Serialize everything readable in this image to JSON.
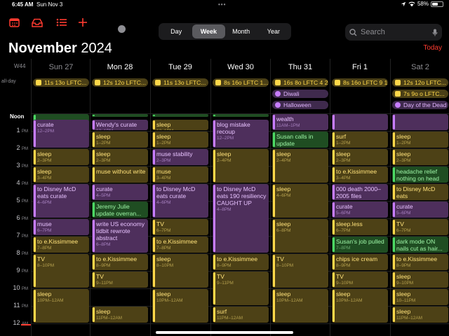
{
  "status": {
    "time": "6:45 AM",
    "date": "Sun Nov 3",
    "battery": "58%",
    "battery_level": 0.58
  },
  "toolbar": {
    "views": [
      "Day",
      "Week",
      "Month",
      "Year"
    ],
    "active_view": "Week",
    "search_placeholder": "Search"
  },
  "header": {
    "month": "November",
    "year": "2024",
    "today_label": "Today",
    "week_label": "W44"
  },
  "days": [
    {
      "label": "Sun 27",
      "weekend": true
    },
    {
      "label": "Mon 28",
      "weekend": false
    },
    {
      "label": "Tue 29",
      "weekend": false
    },
    {
      "label": "Wed 30",
      "weekend": false
    },
    {
      "label": "Thu 31",
      "weekend": false
    },
    {
      "label": "Fri 1",
      "weekend": false
    },
    {
      "label": "Sat 2",
      "weekend": true
    }
  ],
  "allday_label": "all-day",
  "allday_events": [
    {
      "day": 0,
      "row": 0,
      "title": "11s 13o LFTC...",
      "color": "yellow"
    },
    {
      "day": 1,
      "row": 0,
      "title": "12s 12o LFTC...",
      "color": "yellow"
    },
    {
      "day": 2,
      "row": 0,
      "title": "11s 13o LFTC...",
      "color": "yellow"
    },
    {
      "day": 3,
      "row": 0,
      "title": "8s 16o LFTC 1...",
      "color": "yellow"
    },
    {
      "day": 4,
      "row": 0,
      "title": "16s 8o LFTC 4 2",
      "color": "yellow"
    },
    {
      "day": 4,
      "row": 1,
      "title": "Diwali",
      "color": "purple"
    },
    {
      "day": 4,
      "row": 2,
      "title": "Halloween",
      "color": "purple"
    },
    {
      "day": 5,
      "row": 0,
      "title": "8s 16o LFTC 9 1",
      "color": "yellow"
    },
    {
      "day": 6,
      "row": 0,
      "title": "12s 12o LFTC...",
      "color": "yellow"
    },
    {
      "day": 6,
      "row": 1,
      "title": "7s 9o o LFTC...",
      "color": "yellow"
    },
    {
      "day": 6,
      "row": 2,
      "title": "Day of the Dead",
      "color": "purple"
    }
  ],
  "noon_label": "Noon",
  "hours": [
    {
      "n": "1",
      "ap": "PM"
    },
    {
      "n": "2",
      "ap": "PM"
    },
    {
      "n": "3",
      "ap": "PM"
    },
    {
      "n": "4",
      "ap": "PM"
    },
    {
      "n": "5",
      "ap": "PM"
    },
    {
      "n": "6",
      "ap": "PM"
    },
    {
      "n": "7",
      "ap": "PM"
    },
    {
      "n": "8",
      "ap": "PM"
    },
    {
      "n": "9",
      "ap": "PM"
    },
    {
      "n": "10",
      "ap": "PM"
    },
    {
      "n": "11",
      "ap": "PM"
    },
    {
      "n": "12",
      "ap": "AM"
    }
  ],
  "events": [
    {
      "day": 0,
      "start": 12.0,
      "end": 13.0,
      "title": "",
      "time": "",
      "color": "g"
    },
    {
      "day": 0,
      "start": 12.3,
      "end": 14.0,
      "title": "curate",
      "time": "12–2PM",
      "color": "p"
    },
    {
      "day": 0,
      "start": 14.0,
      "end": 15.0,
      "title": "sleep",
      "time": "2–3PM",
      "color": "y"
    },
    {
      "day": 0,
      "start": 15.0,
      "end": 16.0,
      "title": "sleep",
      "time": "3–4PM",
      "color": "y"
    },
    {
      "day": 0,
      "start": 16.0,
      "end": 18.0,
      "title": "to Disney McD eats curate",
      "time": "4–6PM",
      "color": "p"
    },
    {
      "day": 0,
      "start": 18.0,
      "end": 19.0,
      "title": "muse",
      "time": "6–7PM",
      "color": "p"
    },
    {
      "day": 0,
      "start": 19.0,
      "end": 20.0,
      "title": "to e.Kissimmee",
      "time": "7–8PM",
      "color": "y"
    },
    {
      "day": 0,
      "start": 20.0,
      "end": 22.0,
      "title": "TV",
      "time": "8–10PM",
      "color": "y"
    },
    {
      "day": 0,
      "start": 22.0,
      "end": 24.0,
      "title": "sleep",
      "time": "10PM–12AM",
      "color": "y"
    },
    {
      "day": 1,
      "start": 12.0,
      "end": 12.25,
      "title": "",
      "time": "",
      "color": "g"
    },
    {
      "day": 1,
      "start": 12.3,
      "end": 13.0,
      "title": "Wendy's curate",
      "time": "12–1PM",
      "color": "p"
    },
    {
      "day": 1,
      "start": 13.0,
      "end": 14.0,
      "title": "sleep",
      "time": "1–2PM",
      "color": "y"
    },
    {
      "day": 1,
      "start": 14.0,
      "end": 15.0,
      "title": "sleep",
      "time": "2–3PM",
      "color": "y"
    },
    {
      "day": 1,
      "start": 15.0,
      "end": 16.0,
      "title": "muse without write",
      "time": "",
      "color": "y"
    },
    {
      "day": 1,
      "start": 16.0,
      "end": 17.0,
      "title": "curate",
      "time": "4–5PM",
      "color": "p"
    },
    {
      "day": 1,
      "start": 17.0,
      "end": 18.0,
      "title": "Jeremy Julie update overran...",
      "time": "",
      "color": "g"
    },
    {
      "day": 1,
      "start": 18.0,
      "end": 20.0,
      "title": "write US economy tidbit rewrote abstract",
      "time": "6–8PM",
      "color": "p"
    },
    {
      "day": 1,
      "start": 20.0,
      "end": 21.0,
      "title": "to e.Kissimmee",
      "time": "8–9PM",
      "color": "y"
    },
    {
      "day": 1,
      "start": 21.0,
      "end": 22.0,
      "title": "TV",
      "time": "9–11PM",
      "color": "y"
    },
    {
      "day": 1,
      "start": 23.0,
      "end": 24.0,
      "title": "sleep",
      "time": "11PM–12AM",
      "color": "y"
    },
    {
      "day": 2,
      "start": 12.0,
      "end": 12.25,
      "title": "",
      "time": "",
      "color": "g"
    },
    {
      "day": 2,
      "start": 12.3,
      "end": 13.0,
      "title": "sleep",
      "time": "12–1PM",
      "color": "y"
    },
    {
      "day": 2,
      "start": 13.0,
      "end": 14.0,
      "title": "sleep",
      "time": "1–2PM",
      "color": "y"
    },
    {
      "day": 2,
      "start": 14.0,
      "end": 15.0,
      "title": "muse stability",
      "time": "2–3PM",
      "color": "p"
    },
    {
      "day": 2,
      "start": 15.0,
      "end": 16.0,
      "title": "muse",
      "time": "3–4PM",
      "color": "y"
    },
    {
      "day": 2,
      "start": 16.0,
      "end": 18.0,
      "title": "to Disney McD eats curate",
      "time": "4–6PM",
      "color": "p"
    },
    {
      "day": 2,
      "start": 18.0,
      "end": 19.0,
      "title": "TV",
      "time": "6–7PM",
      "color": "y"
    },
    {
      "day": 2,
      "start": 19.0,
      "end": 20.0,
      "title": "to e.Kissimmee",
      "time": "7–8PM",
      "color": "y"
    },
    {
      "day": 2,
      "start": 20.0,
      "end": 22.0,
      "title": "sleep",
      "time": "8–10PM",
      "color": "y"
    },
    {
      "day": 2,
      "start": 22.0,
      "end": 24.0,
      "title": "sleep",
      "time": "10PM–12AM",
      "color": "y"
    },
    {
      "day": 3,
      "start": 12.0,
      "end": 12.25,
      "title": "",
      "time": "",
      "color": "g"
    },
    {
      "day": 3,
      "start": 12.3,
      "end": 14.0,
      "title": "blog mistake recoup",
      "time": "12–2PM",
      "color": "p"
    },
    {
      "day": 3,
      "start": 14.0,
      "end": 16.0,
      "title": "sleep",
      "time": "2–4PM",
      "color": "y"
    },
    {
      "day": 3,
      "start": 16.0,
      "end": 20.0,
      "title": "to Disney McD eats 190 resiliency CAUGHT UP",
      "time": "4–8PM",
      "color": "p"
    },
    {
      "day": 3,
      "start": 20.0,
      "end": 21.0,
      "title": "to e.Kissimmee",
      "time": "8–9PM",
      "color": "y"
    },
    {
      "day": 3,
      "start": 21.0,
      "end": 23.0,
      "title": "TV",
      "time": "9–11PM",
      "color": "y"
    },
    {
      "day": 3,
      "start": 23.0,
      "end": 24.0,
      "title": "surf",
      "time": "11PM–12AM",
      "color": "y"
    },
    {
      "day": 4,
      "start": 12.0,
      "end": 13.0,
      "title": "wealth",
      "time": "11AM–1PM",
      "color": "p"
    },
    {
      "day": 4,
      "start": 13.0,
      "end": 14.0,
      "title": "Susan calls in update",
      "time": "",
      "color": "g"
    },
    {
      "day": 4,
      "start": 14.0,
      "end": 16.0,
      "title": "sleep",
      "time": "2–4PM",
      "color": "y"
    },
    {
      "day": 4,
      "start": 16.0,
      "end": 18.0,
      "title": "sleep",
      "time": "4–6PM",
      "color": "y"
    },
    {
      "day": 4,
      "start": 18.0,
      "end": 20.0,
      "title": "sleep",
      "time": "6–8PM",
      "color": "y"
    },
    {
      "day": 4,
      "start": 20.0,
      "end": 22.0,
      "title": "TV",
      "time": "8–10PM",
      "color": "y"
    },
    {
      "day": 4,
      "start": 22.0,
      "end": 24.0,
      "title": "sleep",
      "time": "10PM–12AM",
      "color": "y"
    },
    {
      "day": 5,
      "start": 12.0,
      "end": 13.0,
      "title": "",
      "time": "",
      "color": "p"
    },
    {
      "day": 5,
      "start": 13.0,
      "end": 14.0,
      "title": "surf",
      "time": "1–2PM",
      "color": "y"
    },
    {
      "day": 5,
      "start": 14.0,
      "end": 15.0,
      "title": "sleep",
      "time": "2–3PM",
      "color": "y"
    },
    {
      "day": 5,
      "start": 15.0,
      "end": 16.0,
      "title": "to e.Kissimmee",
      "time": "3–4PM",
      "color": "y"
    },
    {
      "day": 5,
      "start": 16.0,
      "end": 17.0,
      "title": "000 death 2000–2005 files",
      "time": "",
      "color": "p"
    },
    {
      "day": 5,
      "start": 17.0,
      "end": 18.0,
      "title": "curate",
      "time": "5–6PM",
      "color": "p"
    },
    {
      "day": 5,
      "start": 18.0,
      "end": 19.0,
      "title": "sleep.less",
      "time": "6–7PM",
      "color": "y"
    },
    {
      "day": 5,
      "start": 19.0,
      "end": 20.0,
      "title": "Susan's job pulled",
      "time": "7–8PM",
      "color": "g"
    },
    {
      "day": 5,
      "start": 20.0,
      "end": 21.0,
      "title": "chips ice cream",
      "time": "8–9PM",
      "color": "y"
    },
    {
      "day": 5,
      "start": 21.0,
      "end": 22.0,
      "title": "TV",
      "time": "9–10PM",
      "color": "y"
    },
    {
      "day": 5,
      "start": 22.0,
      "end": 24.0,
      "title": "sleep",
      "time": "10PM–12AM",
      "color": "y"
    },
    {
      "day": 6,
      "start": 12.0,
      "end": 13.0,
      "title": "",
      "time": "",
      "color": "p"
    },
    {
      "day": 6,
      "start": 13.0,
      "end": 14.0,
      "title": "sleep",
      "time": "1–2PM",
      "color": "y"
    },
    {
      "day": 6,
      "start": 14.0,
      "end": 15.0,
      "title": "sleep",
      "time": "2–3PM",
      "color": "y"
    },
    {
      "day": 6,
      "start": 15.0,
      "end": 16.0,
      "title": "headache relief nothing on head",
      "time": "",
      "color": "g"
    },
    {
      "day": 6,
      "start": 16.0,
      "end": 17.0,
      "title": "to Disney McD eats",
      "time": "",
      "color": "y"
    },
    {
      "day": 6,
      "start": 17.0,
      "end": 18.0,
      "title": "curate",
      "time": "5–6PM",
      "color": "p"
    },
    {
      "day": 6,
      "start": 18.0,
      "end": 19.0,
      "title": "TV",
      "time": "6–7PM",
      "color": "y"
    },
    {
      "day": 6,
      "start": 19.0,
      "end": 20.0,
      "title": "dark mode ON nails cut as hair...",
      "time": "",
      "color": "g"
    },
    {
      "day": 6,
      "start": 20.0,
      "end": 21.0,
      "title": "to e.Kissimmee",
      "time": "8–9PM",
      "color": "y"
    },
    {
      "day": 6,
      "start": 21.0,
      "end": 22.0,
      "title": "sleep",
      "time": "9–10PM",
      "color": "y"
    },
    {
      "day": 6,
      "start": 22.0,
      "end": 23.0,
      "title": "sleep",
      "time": "10–11PM",
      "color": "y"
    },
    {
      "day": 6,
      "start": 23.0,
      "end": 24.0,
      "title": "sleep",
      "time": "11PM–12AM",
      "color": "y"
    }
  ]
}
